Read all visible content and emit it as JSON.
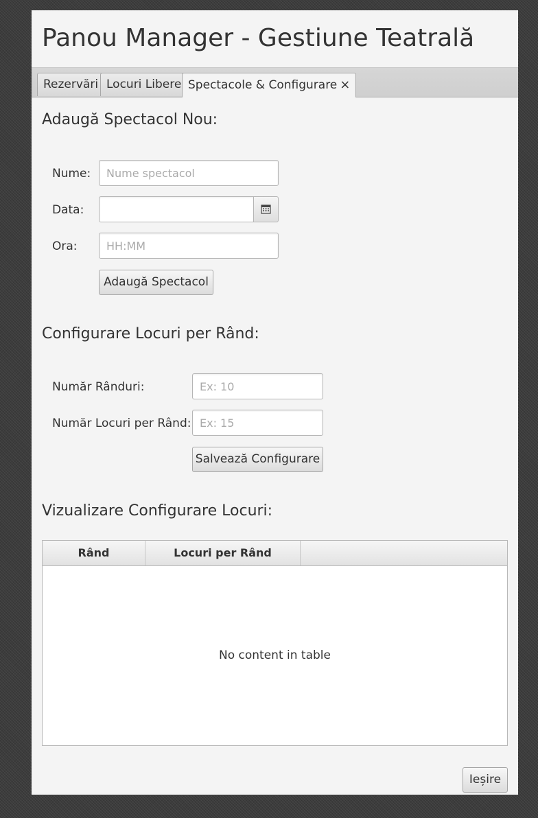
{
  "window": {
    "title": "Panou Manager - Gestiune Teatrală"
  },
  "tabs": [
    {
      "label": "Rezervări",
      "active": false
    },
    {
      "label": "Locuri Libere",
      "active": false
    },
    {
      "label": "Spectacole & Configurare",
      "active": true,
      "closable": true
    }
  ],
  "tab_close_icon": "×",
  "add_show": {
    "heading": "Adaugă Spectacol Nou:",
    "name_label": "Nume:",
    "name_placeholder": "Nume spectacol",
    "name_value": "",
    "date_label": "Data:",
    "date_value": "",
    "date_picker_icon": "calendar-icon",
    "time_label": "Ora:",
    "time_placeholder": "HH:MM",
    "time_value": "",
    "submit_label": "Adaugă Spectacol"
  },
  "seat_config": {
    "heading": "Configurare Locuri per Rând:",
    "rows_label": "Număr Rânduri:",
    "rows_placeholder": "Ex: 10",
    "rows_value": "",
    "seats_label": "Număr Locuri per Rând:",
    "seats_placeholder": "Ex: 15",
    "seats_value": "",
    "save_label": "Salvează Configurare"
  },
  "preview": {
    "heading": "Vizualizare Configurare Locuri:",
    "columns": [
      "Rând",
      "Locuri per Rând"
    ],
    "rows": [],
    "empty_text": "No content in table"
  },
  "footer": {
    "exit_label": "Ieșire"
  },
  "colors": {
    "window_bg": "#f4f4f4",
    "desktop_bg": "#3c3c3c",
    "border": "#b5b5b5"
  }
}
